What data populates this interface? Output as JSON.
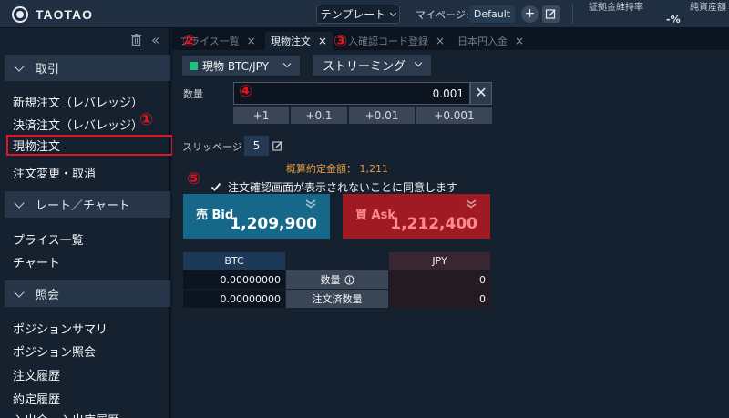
{
  "header": {
    "logo_text": "TAOTAO",
    "template_label": "テンプレート",
    "mypage_label": "マイページ:",
    "default_badge": "Default",
    "add_symbol": "+",
    "margin_ratio_label": "証拠金維持率",
    "margin_ratio_value": "-%",
    "net_assets_label": "純資産額"
  },
  "sidebar": {
    "sections": [
      {
        "label": "取引",
        "items": [
          "新規注文（レバレッジ）",
          "決済注文（レバレッジ）",
          "現物注文",
          "注文変更・取消"
        ]
      },
      {
        "label": "レート／チャート",
        "items": [
          "プライス一覧",
          "チャート"
        ]
      },
      {
        "label": "照会",
        "items": [
          "ポジションサマリ",
          "ポジション照会",
          "注文履歴",
          "約定履歴",
          "入出金・入出庫履歴"
        ]
      }
    ],
    "selected_item": "現物注文"
  },
  "tabs": [
    {
      "label": "プライス一覧",
      "close": "×"
    },
    {
      "label": "現物注文",
      "close": "×"
    },
    {
      "label": "入確認コード登録",
      "close": "×"
    },
    {
      "label": "日本円入金",
      "close": "×"
    }
  ],
  "order": {
    "symbol": "現物 BTC/JPY",
    "mode": "ストリーミング",
    "qty_label": "数量",
    "qty_value": "0.001",
    "clear": "✕",
    "increments": [
      "+1",
      "+0.1",
      "+0.01",
      "+0.001"
    ],
    "slippage_label": "スリッページ",
    "slippage_value": "5",
    "estimate_label": "概算約定金額：",
    "estimate_value": "1,211",
    "agree_text": "注文確認画面が表示されないことに同意します",
    "bid_label": "売 Bid",
    "bid_price": "1,209,900",
    "ask_label": "買 Ask",
    "ask_price": "1,212,400"
  },
  "balance": {
    "headers": [
      "BTC",
      "JPY"
    ],
    "rows": [
      {
        "btc": "0.00000000",
        "label": "数量",
        "jpy": "0"
      },
      {
        "btc": "0.00000000",
        "label": "注文済数量",
        "jpy": "0"
      }
    ]
  },
  "annotations": [
    "①",
    "②",
    "③",
    "④",
    "⑤"
  ],
  "colors": {
    "highlight": "#e3141b",
    "bid": "#16688a",
    "ask": "#a01a23",
    "estimate": "#e59b3a",
    "symbol_dot": "#1fc27c"
  }
}
